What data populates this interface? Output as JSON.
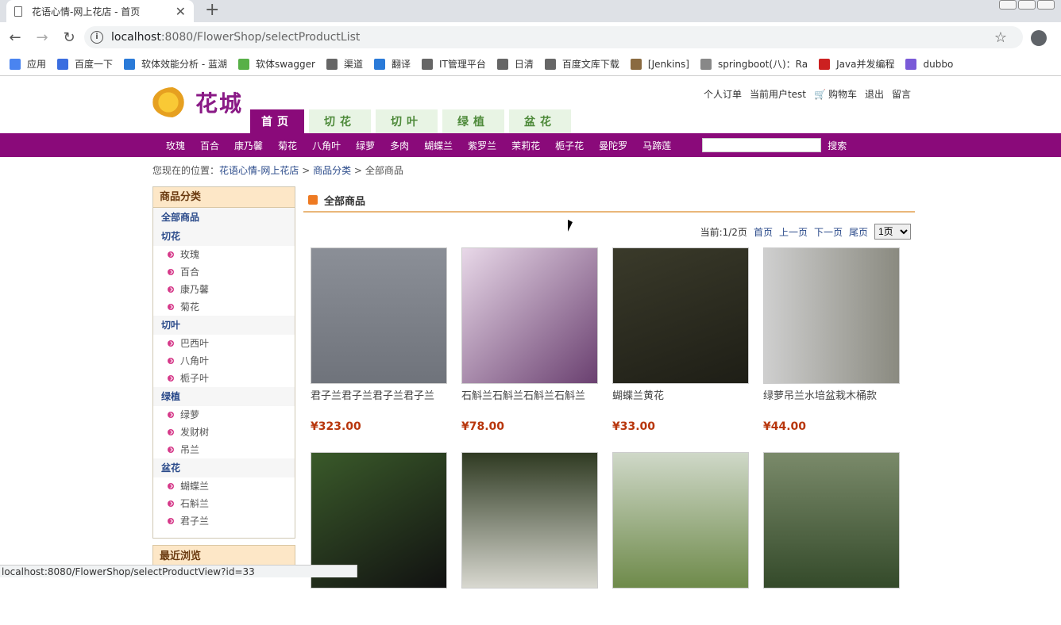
{
  "browser": {
    "tab_title": "花语心情-网上花店 - 首页",
    "url_host": "localhost",
    "url_rest": ":8080/FlowerShop/selectProductList",
    "bookmarks": [
      "应用",
      "百度一下",
      "软体效能分析 - 蓝湖",
      "软体swagger",
      "渠道",
      "翻译",
      "IT管理平台",
      "日清",
      "百度文库下载",
      "[Jenkins]",
      "springboot(八)：Ra",
      "Java并发编程",
      "dubbo"
    ],
    "status_url": "localhost:8080/FlowerShop/selectProductView?id=33"
  },
  "header": {
    "logo_text": "花城",
    "links": {
      "orders": "个人订单",
      "current_user": "当前用户test",
      "cart": "购物车",
      "logout": "退出",
      "message": "留言"
    }
  },
  "mainnav": [
    "首页",
    "切花",
    "切叶",
    "绿植",
    "盆花"
  ],
  "subnav": {
    "categories": [
      "玫瑰",
      "百合",
      "康乃馨",
      "菊花",
      "八角叶",
      "绿萝",
      "多肉",
      "蝴蝶兰",
      "紫罗兰",
      "茉莉花",
      "栀子花",
      "曼陀罗",
      "马蹄莲"
    ],
    "search_label": "搜索"
  },
  "breadcrumb": {
    "prefix": "您现在的位置：",
    "home": "花语心情-网上花店",
    "category": "商品分类",
    "sep": ">",
    "current": "全部商品"
  },
  "sidebar": {
    "title": "商品分类",
    "all": "全部商品",
    "groups": [
      {
        "name": "切花",
        "items": [
          "玫瑰",
          "百合",
          "康乃馨",
          "菊花"
        ]
      },
      {
        "name": "切叶",
        "items": [
          "巴西叶",
          "八角叶",
          "栀子叶"
        ]
      },
      {
        "name": "绿植",
        "items": [
          "绿萝",
          "发财树",
          "吊兰"
        ]
      },
      {
        "name": "盆花",
        "items": [
          "蝴蝶兰",
          "石斛兰",
          "君子兰"
        ]
      }
    ],
    "recent_title": "最近浏览"
  },
  "main": {
    "title": "全部商品",
    "pager": {
      "current": "当前:1/2页",
      "first": "首页",
      "prev": "上一页",
      "next": "下一页",
      "last": "尾页",
      "select_value": "1页"
    },
    "products": [
      {
        "name": "君子兰君子兰君子兰君子兰",
        "price": "¥323.00"
      },
      {
        "name": "石斛兰石斛兰石斛兰石斛兰",
        "price": "¥78.00"
      },
      {
        "name": "蝴蝶兰黄花",
        "price": "¥33.00"
      },
      {
        "name": "绿萝吊兰水培盆栽木桶款",
        "price": "¥44.00"
      },
      {
        "name": "",
        "price": ""
      },
      {
        "name": "",
        "price": ""
      },
      {
        "name": "",
        "price": ""
      },
      {
        "name": "",
        "price": ""
      }
    ]
  }
}
